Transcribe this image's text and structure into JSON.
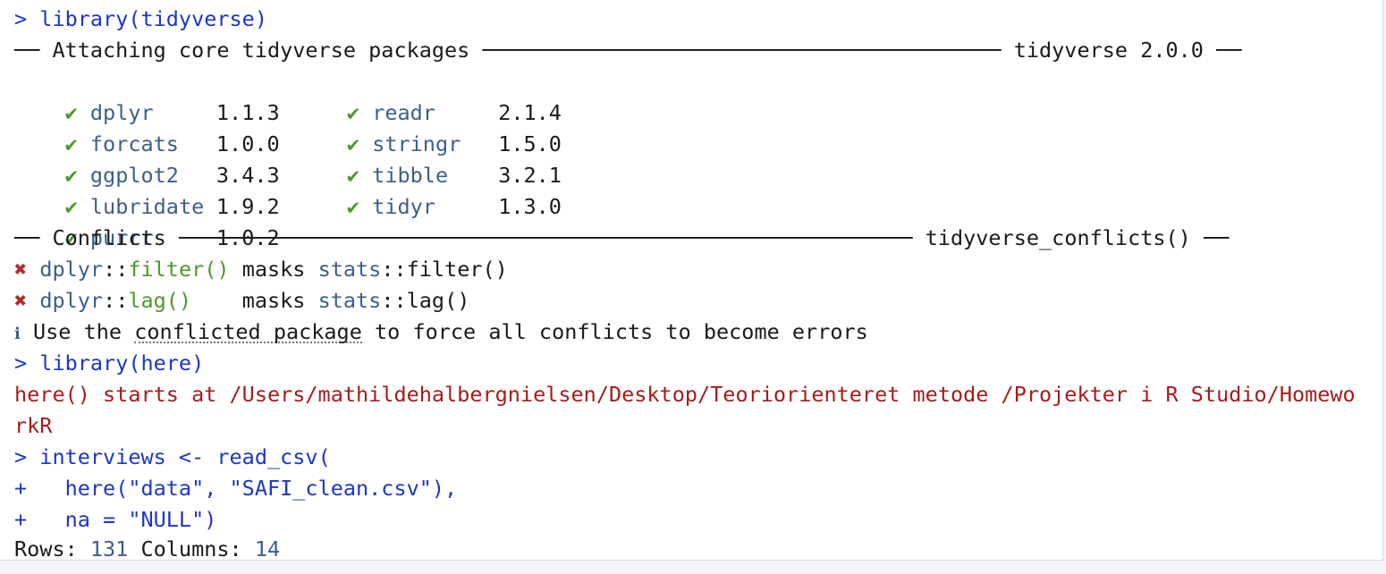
{
  "console": {
    "prompt": ">",
    "continuation": "+",
    "cmd_library_tidyverse": " library(tidyverse)",
    "attach_header": {
      "left_dash": "──",
      "title": " Attaching core tidyverse packages ",
      "rule": "─────────────────────────────────────────",
      "right_label": " tidyverse 2.0.0 ",
      "right_dash": "──"
    },
    "check": "✔",
    "packages": [
      {
        "name": "dplyr",
        "version": "1.1.3"
      },
      {
        "name": "readr",
        "version": "2.1.4"
      },
      {
        "name": "forcats",
        "version": "1.0.0"
      },
      {
        "name": "stringr",
        "version": "1.5.0"
      },
      {
        "name": "ggplot2",
        "version": "3.4.3"
      },
      {
        "name": "tibble",
        "version": "3.2.1"
      },
      {
        "name": "lubridate",
        "version": "1.9.2"
      },
      {
        "name": "tidyr",
        "version": "1.3.0"
      },
      {
        "name": "purrr",
        "version": "1.0.2"
      }
    ],
    "conflicts_header": {
      "left_dash": "──",
      "title": " Conflicts ",
      "rule": "──────────────────────────────────────────────────────────",
      "right_label": " tidyverse_conflicts() ",
      "right_dash": "──"
    },
    "cross": "✖",
    "conflicts": [
      {
        "ns1": "dplyr",
        "sep": "::",
        "fn1": "filter()",
        "masks": " masks ",
        "ns2": "stats",
        "fn2": "filter()"
      },
      {
        "ns1": "dplyr",
        "sep": "::",
        "fn1": "lag()",
        "masks": "    masks ",
        "ns2": "stats",
        "fn2": "lag()"
      }
    ],
    "info_icon": "ℹ",
    "info_pre": " Use the ",
    "info_link": "conflicted package",
    "info_post": " to force all conflicts to become errors",
    "cmd_library_here": " library(here)",
    "here_line1": "here() starts at /Users/mathildehalbergnielsen/Desktop/Teoriorienteret metode /Projekter i R Studio/Homewo",
    "here_line2": "rkR",
    "cmd_read_1": " interviews <- read_csv(",
    "cmd_read_2": "   here(\"data\", \"SAFI_clean.csv\"),",
    "cmd_read_3": "   na = \"NULL\")",
    "rows_label": "Rows: ",
    "rows_value": "131",
    "cols_label": " Columns: ",
    "cols_value": "14"
  },
  "colors": {
    "command": "#1c36c8",
    "package": "#3b5f8a",
    "check": "#4c9a2a",
    "message": "#a61b1b",
    "cross": "#b42b2b"
  }
}
